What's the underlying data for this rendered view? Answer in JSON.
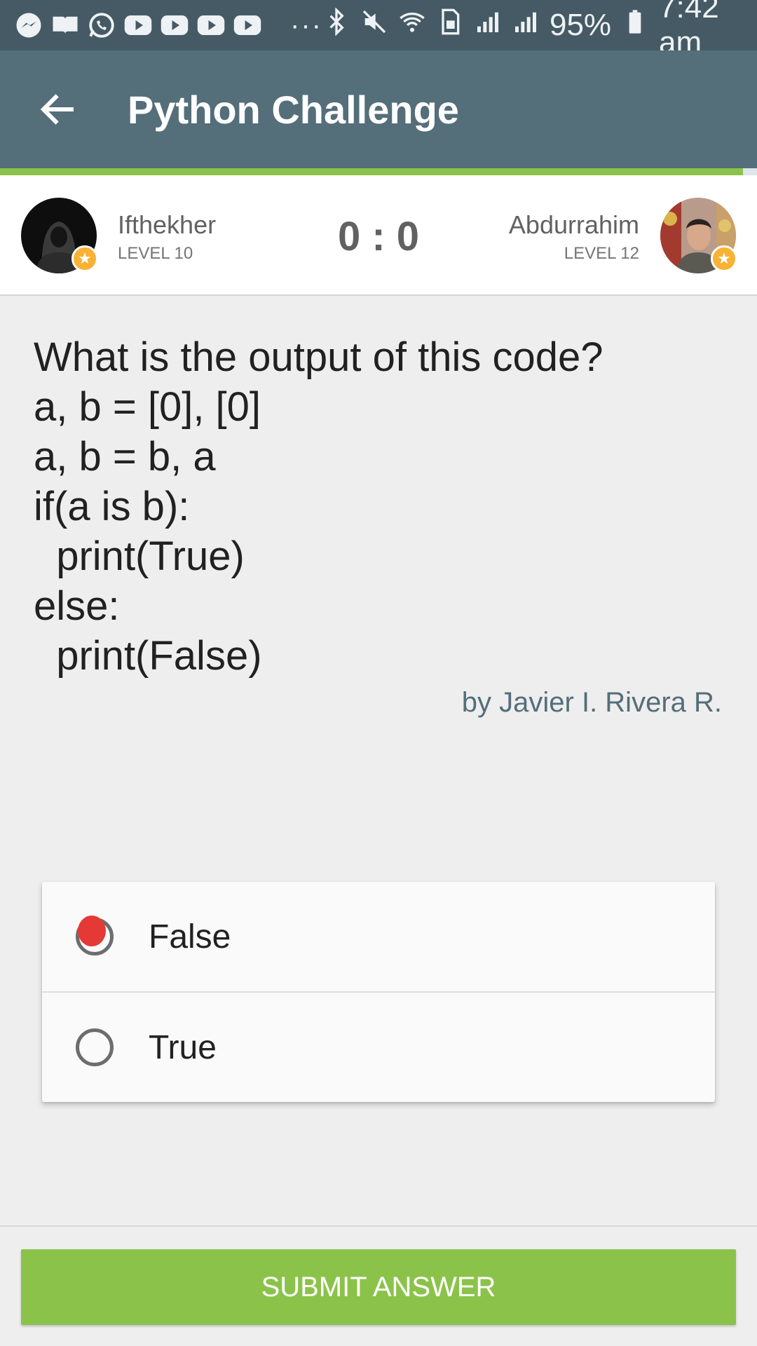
{
  "status_bar": {
    "icons": [
      "messenger-icon",
      "book-icon",
      "whatsapp-icon",
      "youtube-icon",
      "youtube-icon",
      "youtube-icon",
      "youtube-icon"
    ],
    "overflow": "···",
    "battery": "95%",
    "time": "7:42 am"
  },
  "app_bar": {
    "title": "Python Challenge"
  },
  "players": {
    "left": {
      "name": "Ifthekher",
      "level": "LEVEL 10"
    },
    "right": {
      "name": "Abdurrahim",
      "level": "LEVEL 12"
    },
    "score": "0 : 0"
  },
  "question": {
    "text": "What is the output of this code?\na, b = [0], [0]\na, b = b, a\nif(a is b):\n  print(True)\nelse:\n  print(False)",
    "author": "by Javier I. Rivera R."
  },
  "answers": [
    {
      "label": "False",
      "selected": true
    },
    {
      "label": "True",
      "selected": false
    }
  ],
  "submit_label": "SUBMIT ANSWER",
  "colors": {
    "status_bar": "#465a65",
    "app_bar": "#546e7a",
    "accent_green": "#8bc34a",
    "badge": "#f9b233",
    "selected_mark": "#e53935"
  }
}
